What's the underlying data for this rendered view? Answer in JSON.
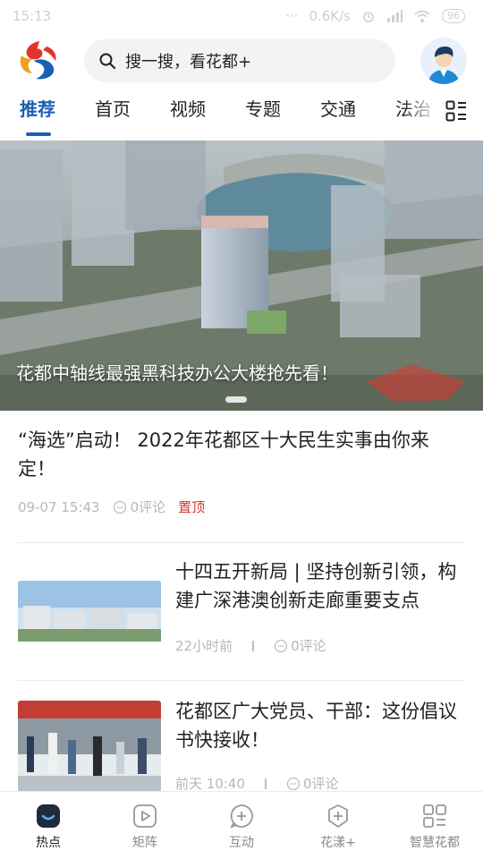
{
  "status_bar": {
    "time": "15:13",
    "dots": "···",
    "net_speed": "0.6K/s",
    "battery": "96"
  },
  "header": {
    "search_placeholder": "搜一搜，看花都+",
    "logo_icon": "huadu-logo-icon",
    "avatar_icon": "user-avatar-icon"
  },
  "tabs": [
    {
      "label": "推荐",
      "active": true
    },
    {
      "label": "首页"
    },
    {
      "label": "视频"
    },
    {
      "label": "专题"
    },
    {
      "label": "交通"
    },
    {
      "label": "法治"
    }
  ],
  "banner": {
    "caption": "花都中轴线最强黑科技办公大楼抢先看！"
  },
  "articles": [
    {
      "title": "“海选”启动！ 2022年花都区十大民生实事由你来定！",
      "time": "09-07 15:43",
      "comments": "0评论",
      "badge": "置顶"
    },
    {
      "title": "十四五开新局 | 坚持创新引领，构建广深港澳创新走廊重要支点",
      "time": "22小时前",
      "comments": "0评论"
    },
    {
      "title": "花都区广大党员、干部：这份倡议书快接收！",
      "time": "前天 10:40",
      "comments": "0评论"
    }
  ],
  "bottom_nav": [
    {
      "label": "热点",
      "icon": "home-hotspot-icon",
      "active": true
    },
    {
      "label": "矩阵",
      "icon": "video-play-icon"
    },
    {
      "label": "互动",
      "icon": "chat-plus-icon"
    },
    {
      "label": "花漾+",
      "icon": "plus-shield-icon"
    },
    {
      "label": "智慧花都",
      "icon": "grid-apps-icon"
    }
  ],
  "colors": {
    "accent": "#1a5fb4",
    "pin": "#d23b2f"
  }
}
